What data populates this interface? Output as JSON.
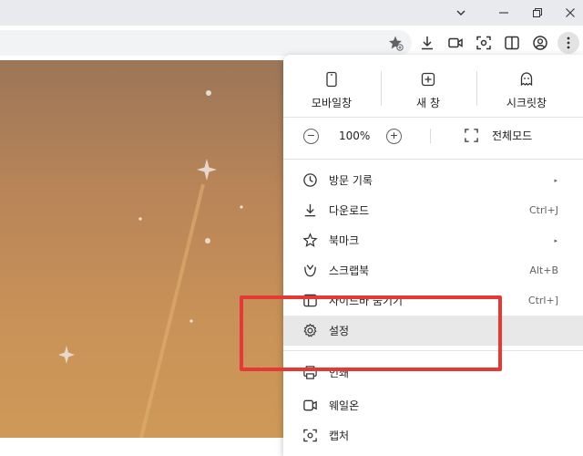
{
  "window": {
    "chevron_icon": "chevron-down-icon",
    "minimize_icon": "minimize-icon",
    "restore_icon": "restore-icon",
    "close_icon": "close-icon"
  },
  "toolbar_icons": [
    "bookmark-star-icon",
    "download-icon",
    "video-icon",
    "screenshot-icon",
    "sidebar-icon",
    "profile-icon",
    "more-menu-icon"
  ],
  "menu": {
    "quick_actions": [
      {
        "label": "모바일창",
        "icon": "mobile-icon"
      },
      {
        "label": "새 창",
        "icon": "new-window-icon"
      },
      {
        "label": "시크릿창",
        "icon": "ghost-icon"
      }
    ],
    "zoom": {
      "minus": "−",
      "value": "100%",
      "plus": "+",
      "fullscreen_label": "전체모드"
    },
    "items": [
      {
        "label": "방문 기록",
        "shortcut": "",
        "arrow": "▸",
        "icon": "history-icon"
      },
      {
        "label": "다운로드",
        "shortcut": "Ctrl+J",
        "arrow": "",
        "icon": "download-icon"
      },
      {
        "label": "북마크",
        "shortcut": "",
        "arrow": "▸",
        "icon": "star-icon"
      },
      {
        "label": "스크랩북",
        "shortcut": "Alt+B",
        "arrow": "",
        "icon": "scrapbook-icon"
      },
      {
        "label": "사이드바 숨기기",
        "shortcut": "Ctrl+]",
        "arrow": "",
        "icon": "sidebar-icon"
      },
      {
        "label": "설정",
        "shortcut": "",
        "arrow": "",
        "icon": "gear-icon"
      },
      {
        "label": "인쇄",
        "shortcut": "",
        "arrow": "",
        "icon": "print-icon"
      },
      {
        "label": "웨일온",
        "shortcut": "",
        "arrow": "",
        "icon": "whaleon-icon"
      },
      {
        "label": "캡처",
        "shortcut": "",
        "arrow": "",
        "icon": "capture-icon"
      }
    ]
  },
  "colors": {
    "highlight": "#e53935",
    "hover_row": "#e8e8e8",
    "page_background_top": "#9b7658",
    "page_background_bottom": "#cf9958"
  }
}
